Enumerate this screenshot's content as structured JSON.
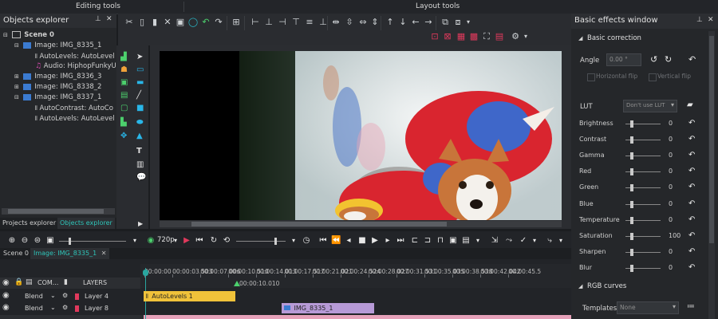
{
  "top_bar": {
    "editing_tools": "Editing tools",
    "layout_tools": "Layout tools"
  },
  "objects_explorer": {
    "title": "Objects explorer",
    "tree": [
      {
        "label": "Scene 0",
        "level": 0,
        "icon": "scene-icon"
      },
      {
        "label": "Image: IMG_8335_1",
        "level": 1,
        "icon": "image-icon"
      },
      {
        "label": "AutoLevels: AutoLevel",
        "level": 2,
        "icon": "effect-icon"
      },
      {
        "label": "Audio: HiphopFunkyU",
        "level": 2,
        "icon": "audio-icon"
      },
      {
        "label": "Image: IMG_8336_3",
        "level": 1,
        "icon": "image-icon"
      },
      {
        "label": "Image: IMG_8338_2",
        "level": 1,
        "icon": "image-icon"
      },
      {
        "label": "Image: IMG_8337_1",
        "level": 1,
        "icon": "image-icon"
      },
      {
        "label": "AutoContrast: AutoCo",
        "level": 2,
        "icon": "effect-icon"
      },
      {
        "label": "AutoLevels: AutoLevel",
        "level": 2,
        "icon": "effect-icon"
      }
    ],
    "tabs": [
      "Projects explorer",
      "Objects explorer"
    ]
  },
  "effects_window": {
    "title": "Basic effects window",
    "section": "Basic correction",
    "angle_label": "Angle",
    "angle_value": "0.00 °",
    "hflip": "Horizontal flip",
    "vflip": "Vertical flip",
    "lut_label": "LUT",
    "lut_value": "Don't use LUT",
    "sliders": [
      {
        "label": "Brightness",
        "value": "0"
      },
      {
        "label": "Contrast",
        "value": "0"
      },
      {
        "label": "Gamma",
        "value": "0"
      },
      {
        "label": "Red",
        "value": "0"
      },
      {
        "label": "Green",
        "value": "0"
      },
      {
        "label": "Blue",
        "value": "0"
      },
      {
        "label": "Temperature",
        "value": "0"
      },
      {
        "label": "Saturation",
        "value": "100"
      },
      {
        "label": "Sharpen",
        "value": "0"
      },
      {
        "label": "Blur",
        "value": "0"
      }
    ],
    "rgb_curves": "RGB curves",
    "templates_label": "Templates:",
    "templates_value": "None"
  },
  "playback": {
    "resolution": "720p"
  },
  "timeline": {
    "tabs": [
      "Scene 0",
      "Image: IMG_8335_1"
    ],
    "header": {
      "com": "COM...",
      "layers": "LAYERS"
    },
    "ruler": [
      "00:00:00",
      "00:00:03.503",
      "00:00:07.006",
      "00:00:10.510",
      "00:00:14.013",
      "00:00:17.517",
      "00:00:21.021",
      "00:00:24.524",
      "00:00:28.027",
      "00:00:31.531",
      "00:00:35.035",
      "00:00:38.538",
      "00:00:42.042",
      "00:00:45.5"
    ],
    "cursor": "00:00:10.010",
    "layers": [
      {
        "blend": "Blend",
        "name": "Layer 4"
      },
      {
        "blend": "Blend",
        "name": "Layer 8"
      }
    ],
    "clips": [
      {
        "label": "AutoLevels 1",
        "color": "#f0c23a"
      },
      {
        "label": "IMG_8335_1",
        "color": "#b79ad7"
      }
    ]
  },
  "colors": {
    "accent": "#2aa6a0",
    "selection": "#1e5f85",
    "record": "#e0395c"
  }
}
